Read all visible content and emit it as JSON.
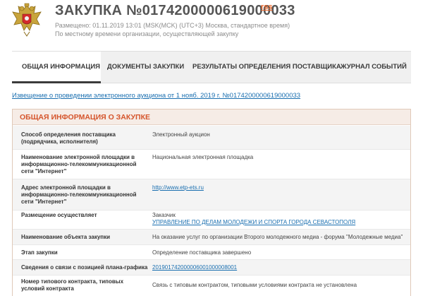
{
  "header": {
    "title": "ЗАКУПКА №0174200000619000033",
    "rss": "rss",
    "published": "Размещено: 01.11.2019 13:01 (MSK(MCK) (UTC+3) Москва, стандартное время)",
    "timezone": "По местному времени организации, осуществляющей закупку"
  },
  "tabs": [
    {
      "label": "ОБЩАЯ ИНФОРМАЦИЯ",
      "active": true
    },
    {
      "label": "ДОКУМЕНТЫ ЗАКУПКИ",
      "active": false
    },
    {
      "label": "РЕЗУЛЬТАТЫ ОПРЕДЕЛЕНИЯ ПОСТАВЩИКА",
      "active": false
    },
    {
      "label": "ЖУРНАЛ СОБЫТИЙ",
      "active": false
    }
  ],
  "notice_link": "Извещение о проведении электронного аукциона от 1 нояб. 2019 г. №0174200000619000033",
  "section": {
    "title": "ОБЩАЯ ИНФОРМАЦИЯ О ЗАКУПКЕ",
    "rows": [
      {
        "label": "Способ определения поставщика (подрядчика, исполнителя)",
        "value": "Электронный аукцион"
      },
      {
        "label": "Наименование электронной площадки в информационно-телекоммуникационной сети \"Интернет\"",
        "value": "Национальная электронная площадка"
      },
      {
        "label": "Адрес электронной площадки в информационно-телекоммуникационной сети \"Интернет\"",
        "value": "http://www.etp-ets.ru"
      },
      {
        "label": "Размещение осуществляет",
        "value": "Заказчик",
        "value_link": "УПРАВЛЕНИЕ ПО ДЕЛАМ МОЛОДЕЖИ И СПОРТА ГОРОДА СЕВАСТОПОЛЯ"
      },
      {
        "label": "Наименование объекта закупки",
        "value": "На оказание услуг по организации Второго молодежного медиа - форума \"Молодежные медиа\""
      },
      {
        "label": "Этап закупки",
        "value": "Определение поставщика завершено"
      },
      {
        "label": "Сведения о связи с позицией плана-графика",
        "value": "201901742000006001000008001"
      },
      {
        "label": "Номер типового контракта, типовых условий контракта",
        "value": "Связь с типовым контрактом, типовыми условиями контракта не установлена"
      }
    ]
  }
}
